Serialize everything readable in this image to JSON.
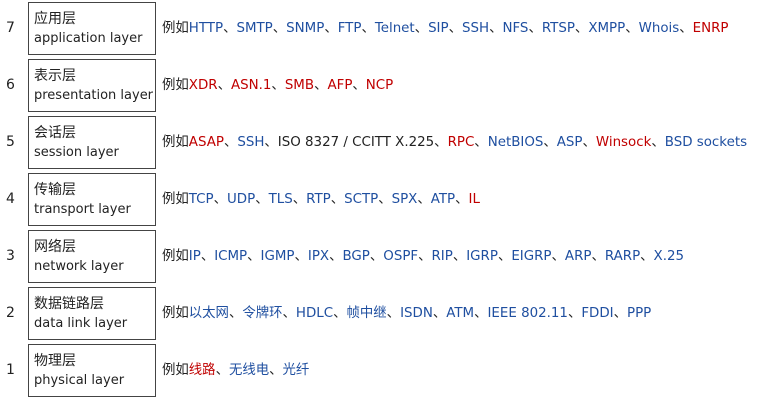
{
  "prefix": "例如",
  "separator": "、",
  "colors": {
    "blue": "#1f4fa0",
    "red": "#c00000",
    "black": "#222222"
  },
  "layers": [
    {
      "number": "7",
      "name_zh": "应用层",
      "name_en": "application layer",
      "protocols": [
        {
          "text": "HTTP",
          "color": "blue"
        },
        {
          "text": "SMTP",
          "color": "blue"
        },
        {
          "text": "SNMP",
          "color": "blue"
        },
        {
          "text": "FTP",
          "color": "blue"
        },
        {
          "text": "Telnet",
          "color": "blue"
        },
        {
          "text": "SIP",
          "color": "blue"
        },
        {
          "text": "SSH",
          "color": "blue"
        },
        {
          "text": "NFS",
          "color": "blue"
        },
        {
          "text": "RTSP",
          "color": "blue"
        },
        {
          "text": "XMPP",
          "color": "blue"
        },
        {
          "text": "Whois",
          "color": "blue"
        },
        {
          "text": "ENRP",
          "color": "red"
        }
      ]
    },
    {
      "number": "6",
      "name_zh": "表示层",
      "name_en": "presentation layer",
      "protocols": [
        {
          "text": "XDR",
          "color": "red"
        },
        {
          "text": "ASN.1",
          "color": "red"
        },
        {
          "text": "SMB",
          "color": "red"
        },
        {
          "text": "AFP",
          "color": "red"
        },
        {
          "text": "NCP",
          "color": "red"
        }
      ]
    },
    {
      "number": "5",
      "name_zh": "会话层",
      "name_en": "session layer",
      "protocols": [
        {
          "text": "ASAP",
          "color": "red"
        },
        {
          "text": "SSH",
          "color": "blue"
        },
        {
          "text": "ISO 8327 / CCITT X.225",
          "color": "black"
        },
        {
          "text": "RPC",
          "color": "red"
        },
        {
          "text": "NetBIOS",
          "color": "blue"
        },
        {
          "text": "ASP",
          "color": "blue"
        },
        {
          "text": "Winsock",
          "color": "red"
        },
        {
          "text": "BSD sockets",
          "color": "blue"
        }
      ]
    },
    {
      "number": "4",
      "name_zh": "传输层",
      "name_en": "transport layer",
      "protocols": [
        {
          "text": "TCP",
          "color": "blue"
        },
        {
          "text": "UDP",
          "color": "blue"
        },
        {
          "text": "TLS",
          "color": "blue"
        },
        {
          "text": "RTP",
          "color": "blue"
        },
        {
          "text": "SCTP",
          "color": "blue"
        },
        {
          "text": "SPX",
          "color": "blue"
        },
        {
          "text": "ATP",
          "color": "blue"
        },
        {
          "text": "IL",
          "color": "red"
        }
      ]
    },
    {
      "number": "3",
      "name_zh": "网络层",
      "name_en": "network layer",
      "protocols": [
        {
          "text": "IP",
          "color": "blue"
        },
        {
          "text": "ICMP",
          "color": "blue"
        },
        {
          "text": "IGMP",
          "color": "blue"
        },
        {
          "text": "IPX",
          "color": "blue"
        },
        {
          "text": "BGP",
          "color": "blue"
        },
        {
          "text": "OSPF",
          "color": "blue"
        },
        {
          "text": "RIP",
          "color": "blue"
        },
        {
          "text": "IGRP",
          "color": "blue"
        },
        {
          "text": "EIGRP",
          "color": "blue"
        },
        {
          "text": "ARP",
          "color": "blue"
        },
        {
          "text": "RARP",
          "color": "blue"
        },
        {
          "text": "X.25",
          "color": "blue"
        }
      ]
    },
    {
      "number": "2",
      "name_zh": "数据链路层",
      "name_en": "data link layer",
      "protocols": [
        {
          "text": "以太网",
          "color": "blue"
        },
        {
          "text": "令牌环",
          "color": "blue"
        },
        {
          "text": "HDLC",
          "color": "blue"
        },
        {
          "text": "帧中继",
          "color": "blue"
        },
        {
          "text": "ISDN",
          "color": "blue"
        },
        {
          "text": "ATM",
          "color": "blue"
        },
        {
          "text": "IEEE 802.11",
          "color": "blue"
        },
        {
          "text": "FDDI",
          "color": "blue"
        },
        {
          "text": "PPP",
          "color": "blue"
        }
      ]
    },
    {
      "number": "1",
      "name_zh": "物理层",
      "name_en": "physical layer",
      "protocols": [
        {
          "text": "线路",
          "color": "red"
        },
        {
          "text": "无线电",
          "color": "blue"
        },
        {
          "text": "光纤",
          "color": "blue"
        }
      ]
    }
  ]
}
